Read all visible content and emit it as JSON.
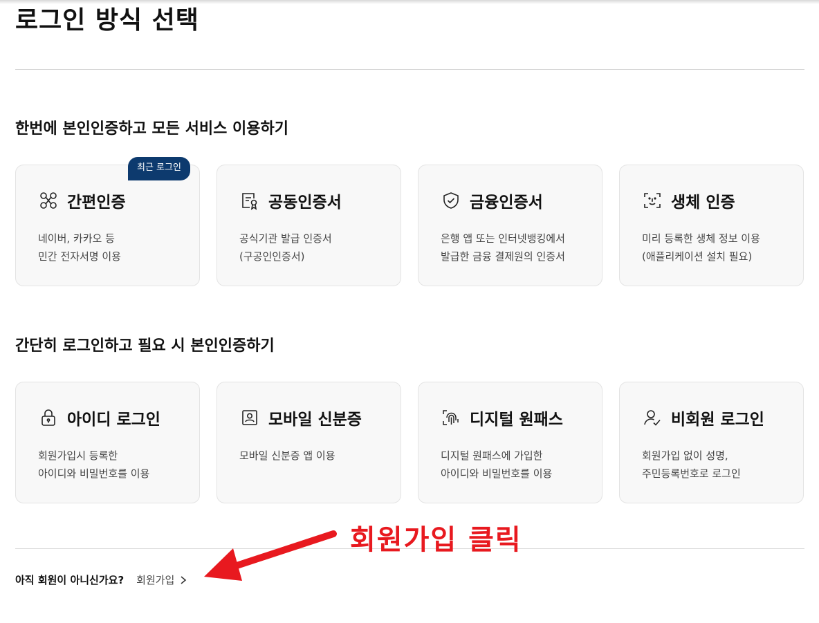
{
  "page": {
    "title": "로그인 방식 선택"
  },
  "section_identity": {
    "title": "한번에 본인인증하고 모든 서비스 이용하기",
    "recent_badge": "최근 로그인",
    "cards": [
      {
        "title": "간편인증",
        "icon": "simple-auth-icon",
        "desc1": "네이버, 카카오 등",
        "desc2": "민간 전자서명 이용"
      },
      {
        "title": "공동인증서",
        "icon": "joint-certificate-icon",
        "desc1": "공식기관 발급 인증서",
        "desc2": "(구공인인증서)"
      },
      {
        "title": "금융인증서",
        "icon": "shield-check-icon",
        "desc1": "은행 앱 또는 인터넷뱅킹에서",
        "desc2": "발급한 금융 결제원의 인증서"
      },
      {
        "title": "생체 인증",
        "icon": "face-scan-icon",
        "desc1": "미리 등록한 생체 정보 이용",
        "desc2": "(애플리케이션 설치 필요)"
      }
    ]
  },
  "section_login": {
    "title": "간단히 로그인하고 필요 시 본인인증하기",
    "cards": [
      {
        "title": "아이디 로그인",
        "icon": "lock-icon",
        "desc1": "회원가입시 등록한",
        "desc2": "아이디와 비밀번호를 이용"
      },
      {
        "title": "모바일 신분증",
        "icon": "id-card-icon",
        "desc1": "모바일 신분증 앱 이용",
        "desc2": ""
      },
      {
        "title": "디지털 원패스",
        "icon": "fingerprint-icon",
        "desc1": "디지털 원패스에 가입한",
        "desc2": "아이디와 비밀번호를 이용"
      },
      {
        "title": "비회원 로그인",
        "icon": "user-check-icon",
        "desc1": "회원가입 없이 성명,",
        "desc2": "주민등록번호로 로그인"
      }
    ]
  },
  "signup": {
    "question": "아직 회원이 아니신가요?",
    "link_label": "회원가입"
  },
  "annotation": {
    "text": "회원가입 클릭",
    "color": "#e8191f"
  },
  "colors": {
    "badge_bg": "#0d3a6e",
    "card_bg": "#f8f8f8"
  }
}
